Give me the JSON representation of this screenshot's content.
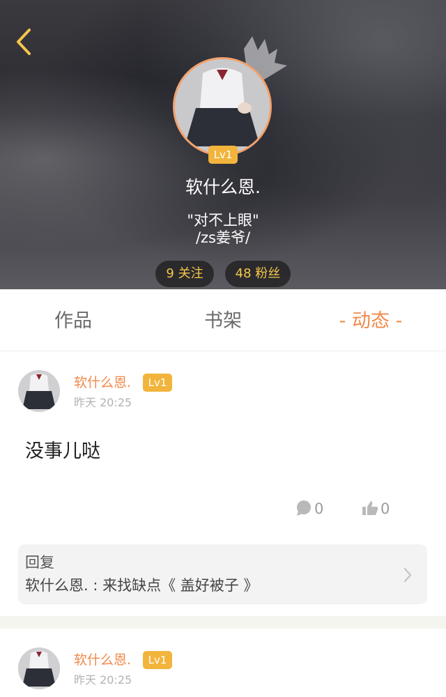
{
  "profile": {
    "username": "软什么恩.",
    "level": "Lv1",
    "bio_line1": "\"对不上眼\"",
    "bio_line2": "/zs姜爷/",
    "following": "9 关注",
    "followers": "48 粉丝"
  },
  "tabs": [
    {
      "label": "作品"
    },
    {
      "label": "书架"
    },
    {
      "label": "- 动态 -",
      "active": true
    }
  ],
  "posts": [
    {
      "author": "软什么恩.",
      "level": "Lv1",
      "time": "昨天 20:25",
      "content": "没事儿哒",
      "comments": "0",
      "likes": "0",
      "reply_title": "回复",
      "reply_text": "软什么恩. : 来找缺点《 盖好被子 》"
    },
    {
      "author": "软什么恩.",
      "level": "Lv1",
      "time": "昨天 20:25"
    }
  ],
  "colors": {
    "accent": "#f0894a",
    "badge": "#f2b43c",
    "stat_text": "#f5c64a"
  },
  "icons": [
    "back-arrow-icon",
    "crown-icon",
    "comment-icon",
    "thumbs-up-icon",
    "chevron-right-icon"
  ]
}
